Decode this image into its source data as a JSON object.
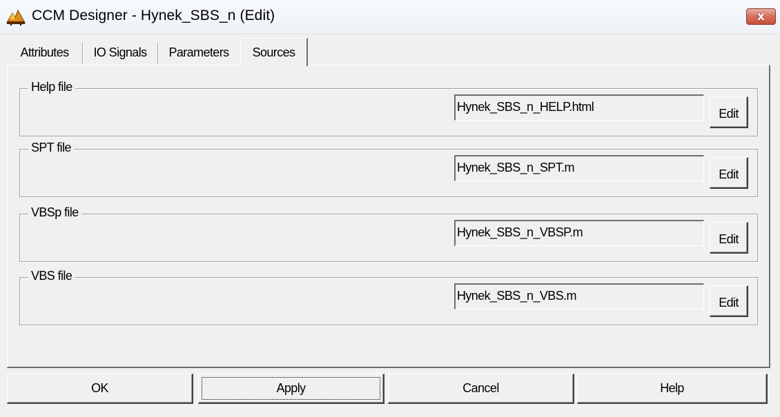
{
  "window": {
    "title": "CCM Designer - Hynek_SBS_n (Edit)",
    "close_symbol": "x",
    "icon": "ccm-designer-app-icon"
  },
  "tabs": [
    {
      "label": "Attributes",
      "active": false
    },
    {
      "label": "IO Signals",
      "active": false
    },
    {
      "label": "Parameters",
      "active": false
    },
    {
      "label": "Sources",
      "active": true
    }
  ],
  "groups": [
    {
      "label": "Help file",
      "value": "Hynek_SBS_n_HELP.html",
      "button": "Edit"
    },
    {
      "label": "SPT file",
      "value": "Hynek_SBS_n_SPT.m",
      "button": "Edit"
    },
    {
      "label": "VBSp file",
      "value": "Hynek_SBS_n_VBSP.m",
      "button": "Edit"
    },
    {
      "label": "VBS file",
      "value": "Hynek_SBS_n_VBS.m",
      "button": "Edit"
    }
  ],
  "buttons": {
    "ok": "OK",
    "apply": "Apply",
    "cancel": "Cancel",
    "help": "Help"
  },
  "colors": {
    "close_button": "#d4705d",
    "background": "#f0f0f0"
  }
}
